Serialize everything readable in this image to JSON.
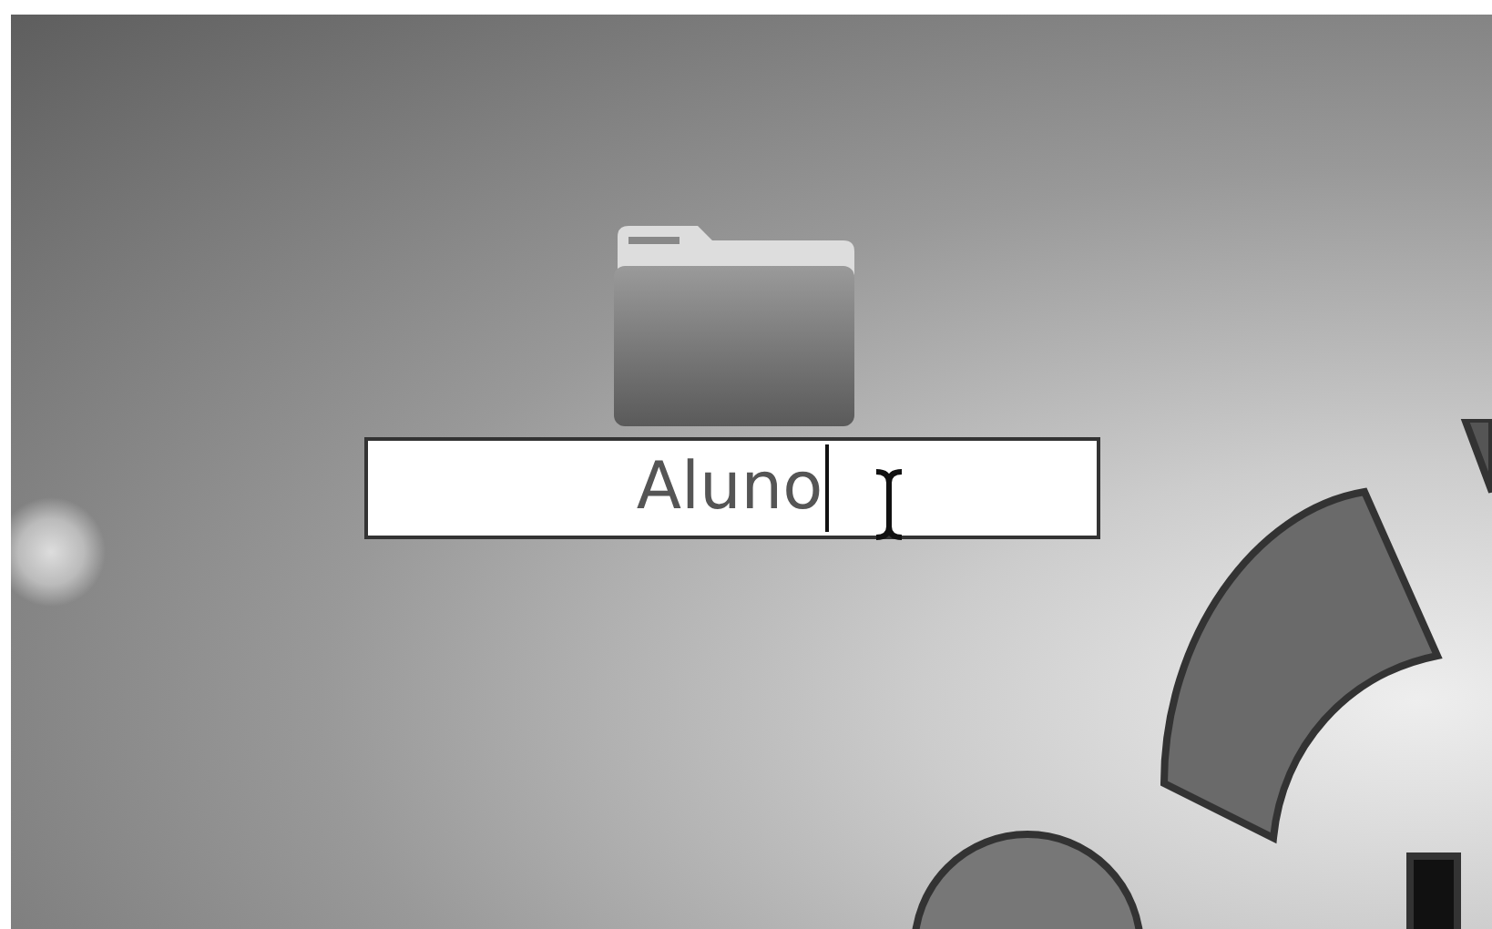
{
  "desktop_icon": {
    "name_field": {
      "value": "Aluno"
    }
  }
}
